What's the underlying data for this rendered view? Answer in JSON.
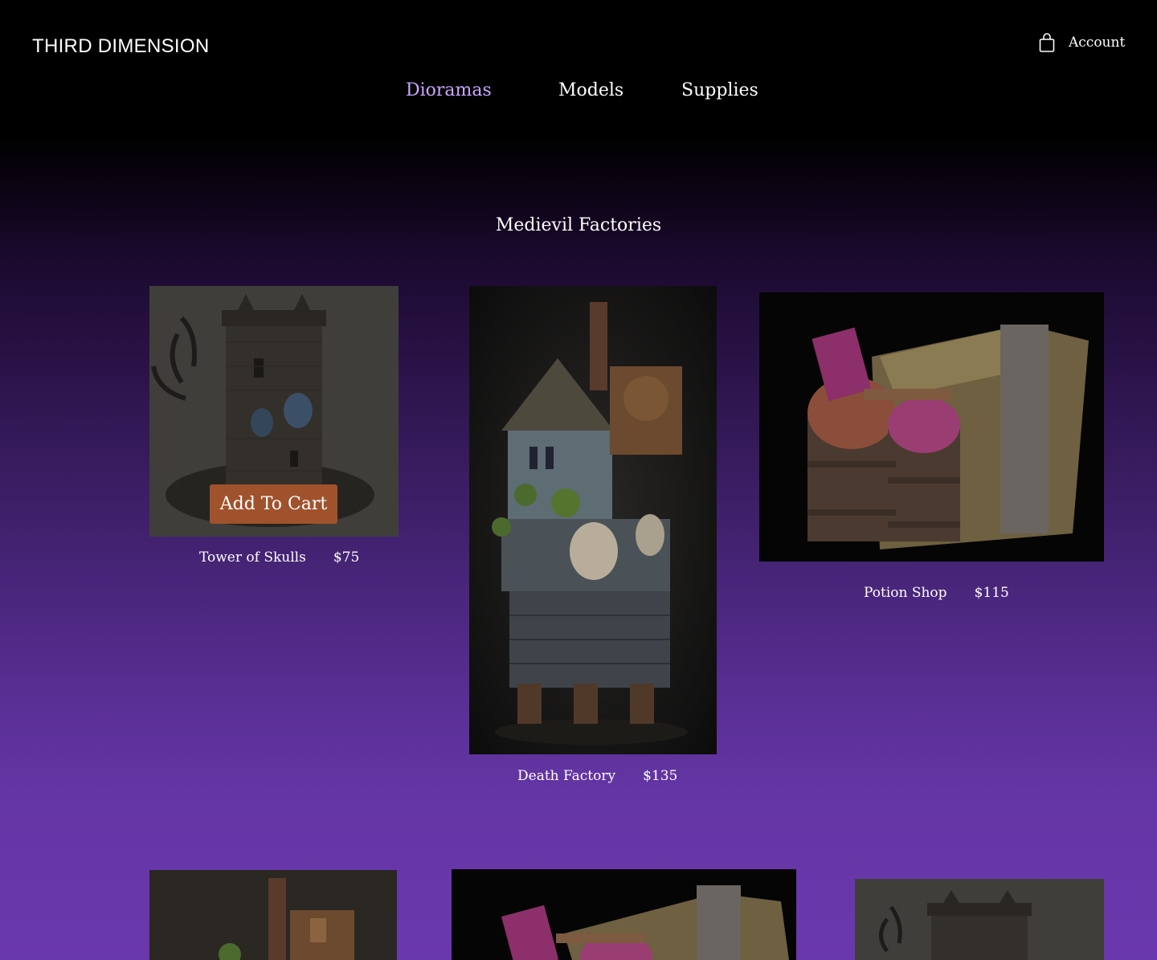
{
  "header": {
    "brand": "THIRD DIMENSION",
    "account_label": "Account",
    "cart_icon": "shopping-bag-icon"
  },
  "nav": {
    "items": [
      {
        "label": "Dioramas",
        "active": true
      },
      {
        "label": "Models",
        "active": false
      },
      {
        "label": "Supplies",
        "active": false
      }
    ]
  },
  "section": {
    "title": "Medievil Factories"
  },
  "products": [
    {
      "name": "Tower of Skulls",
      "price": "$75",
      "hover_action": "Add To Cart"
    },
    {
      "name": "Death Factory",
      "price": "$135"
    },
    {
      "name": "Potion Shop",
      "price": "$115"
    }
  ],
  "colors": {
    "accent": "#c9a7ff",
    "button": "#a0522d",
    "gradient_end": "#6a38ad"
  }
}
